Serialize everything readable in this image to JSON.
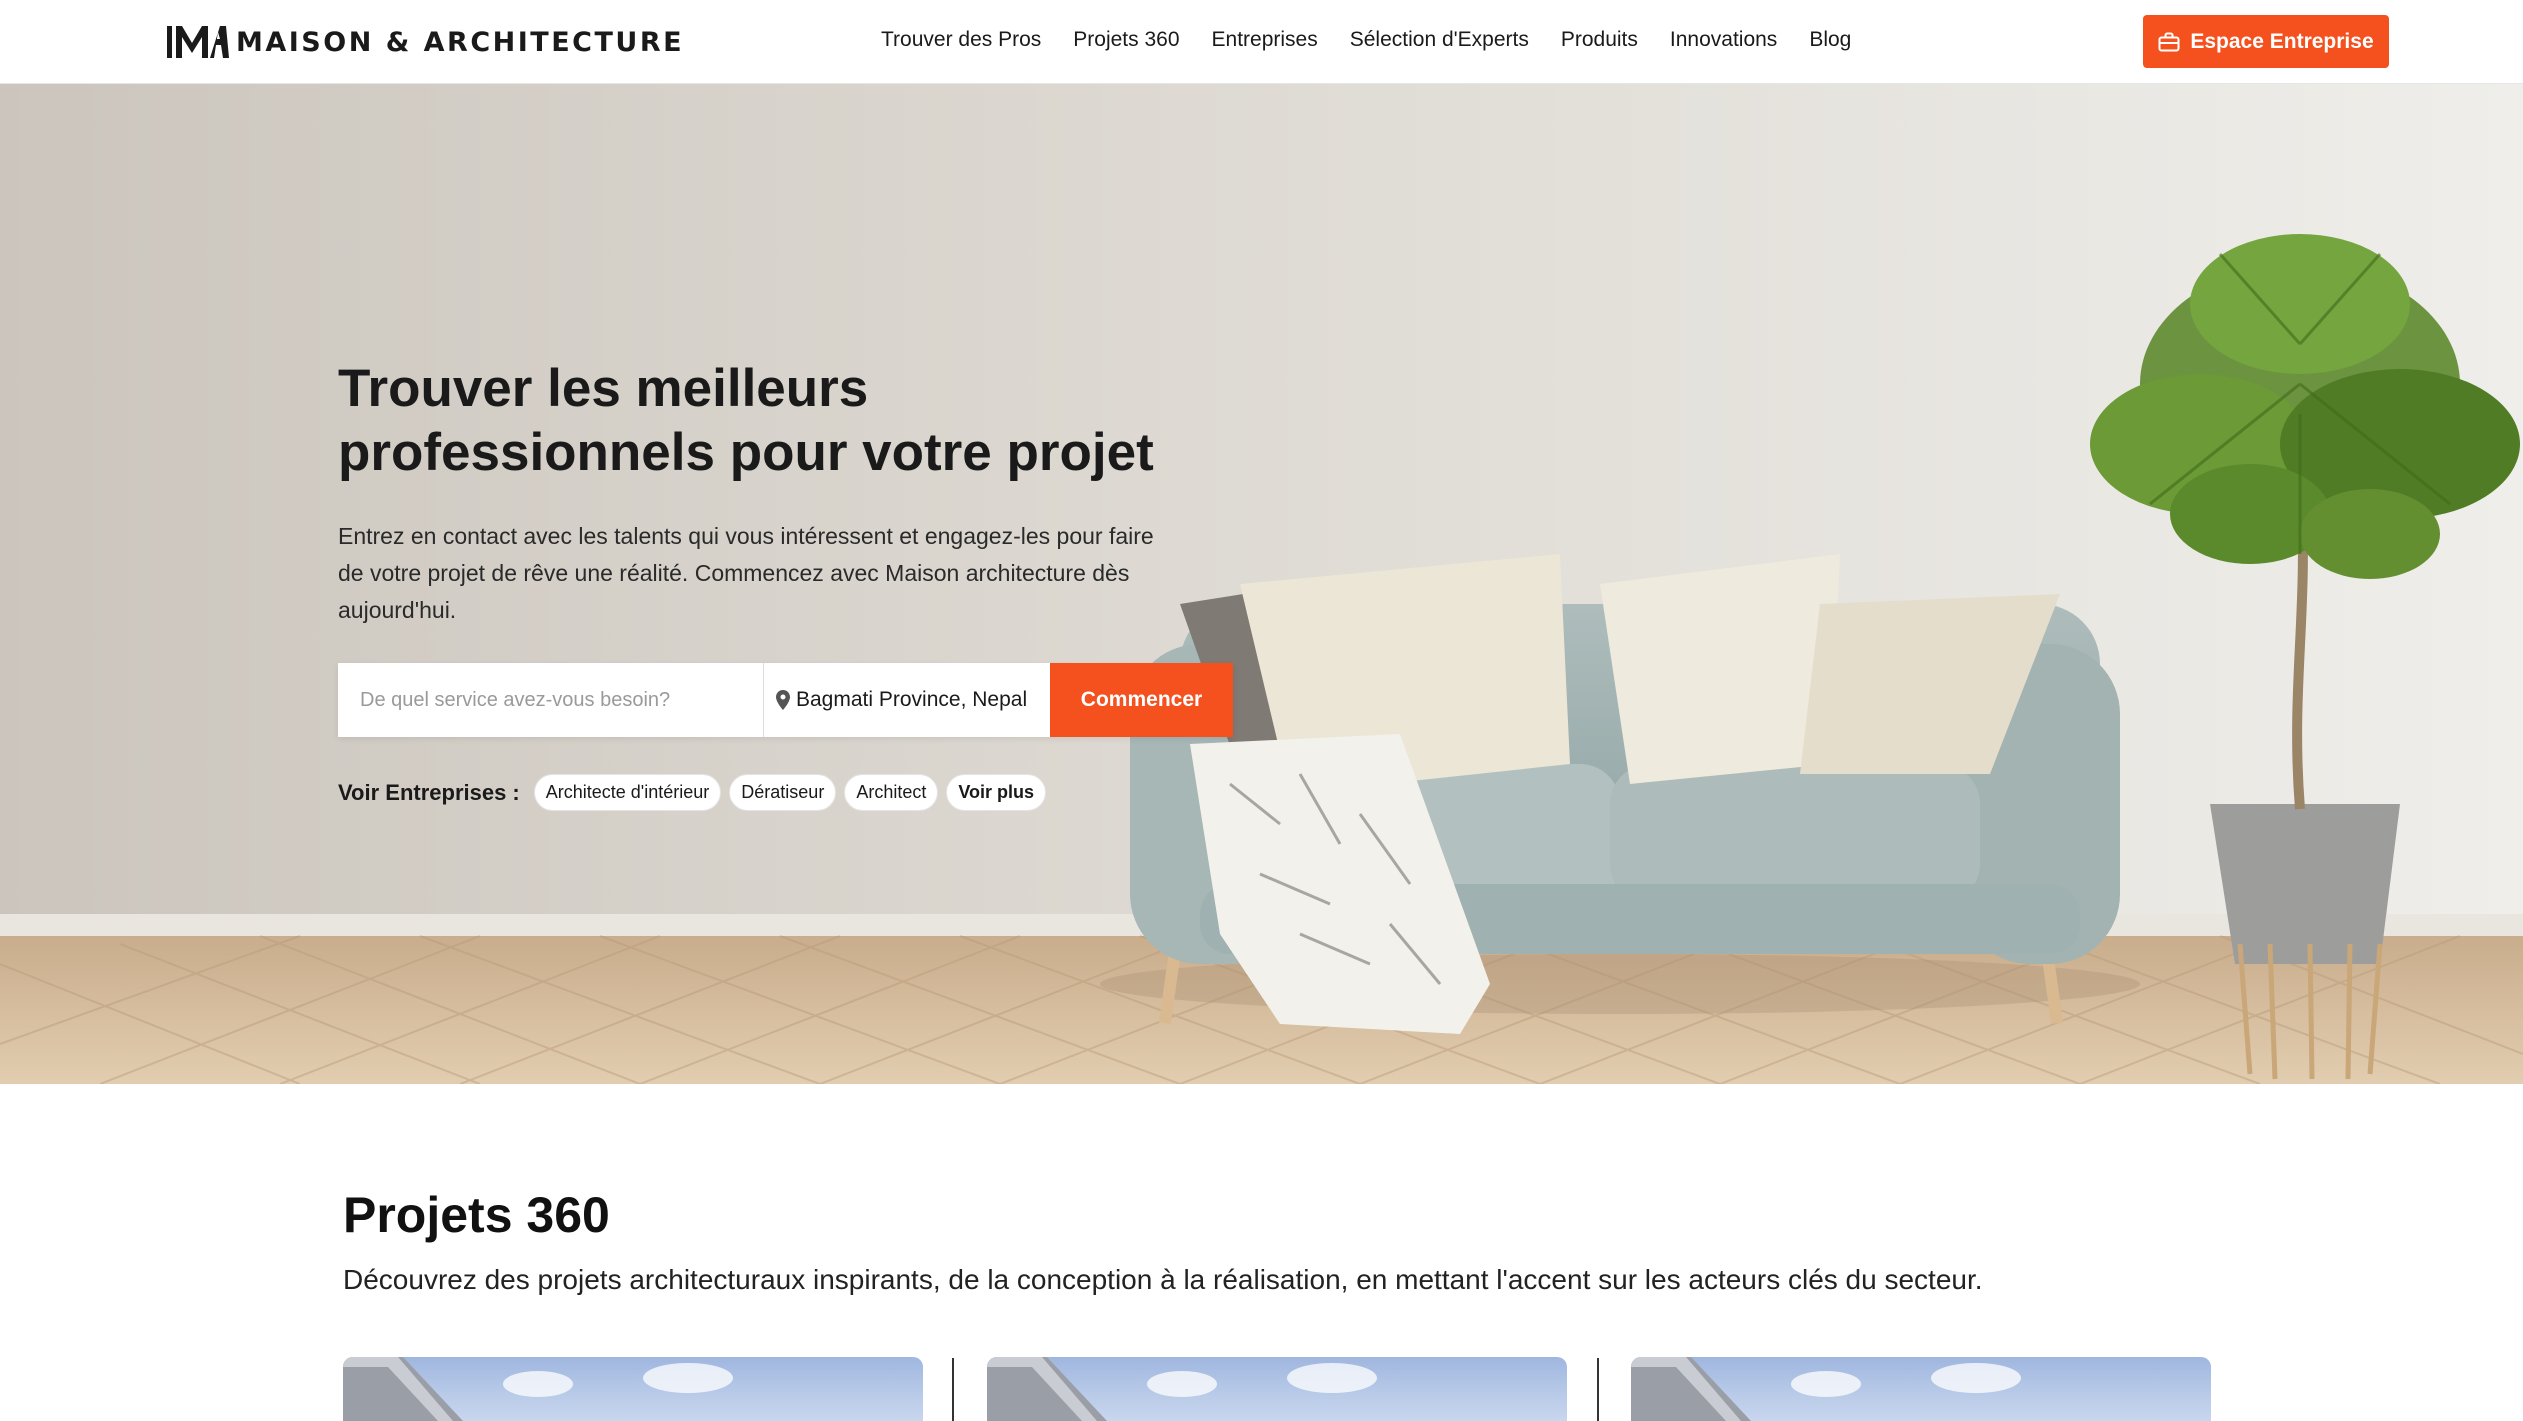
{
  "header": {
    "logo_text": "MAISON & ARCHITECTURE",
    "nav": [
      {
        "label": "Trouver des Pros"
      },
      {
        "label": "Projets 360"
      },
      {
        "label": "Entreprises"
      },
      {
        "label": "Sélection d'Experts"
      },
      {
        "label": "Produits"
      },
      {
        "label": "Innovations"
      },
      {
        "label": "Blog"
      }
    ],
    "cta_label": "Espace Entreprise",
    "cta_icon": "briefcase-icon"
  },
  "hero": {
    "title": "Trouver les meilleurs professionnels pour votre projet",
    "subtitle": "Entrez en contact avec les talents qui vous intéressent et engagez-les pour faire de votre projet de rêve une réalité. Commencez avec Maison architecture dès aujourd'hui.",
    "search": {
      "placeholder": "De quel service avez-vous besoin?",
      "location": "Bagmati Province, Nepal",
      "location_icon": "map-pin-icon",
      "button": "Commencer"
    },
    "voir_label": "Voir Entreprises :",
    "chips": [
      {
        "label": "Architecte d'intérieur"
      },
      {
        "label": "Dératiseur"
      },
      {
        "label": "Architect"
      },
      {
        "label": "Voir plus"
      }
    ]
  },
  "projects": {
    "title": "Projets 360",
    "subtitle": "Découvrez des projets architecturaux inspirants, de la conception à la réalisation, en mettant l'accent sur les acteurs clés du secteur."
  },
  "colors": {
    "accent": "#f4511e",
    "text": "#1a1a1a"
  }
}
